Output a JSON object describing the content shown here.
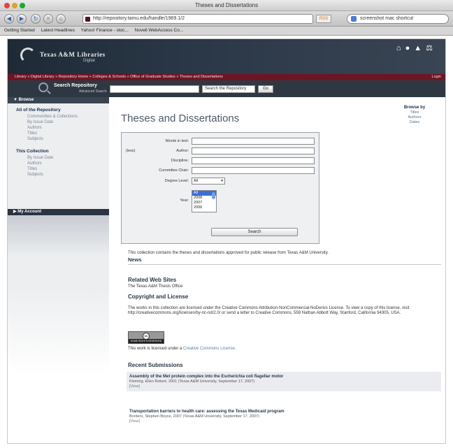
{
  "window": {
    "title": "Theses and Dissertations"
  },
  "toolbar": {
    "url": "http://repository.tamu.edu/handle/1969.1/2",
    "search_value": "screenshot mac shortcut"
  },
  "bookmarks": [
    "Getting Started",
    "Latest Headlines",
    "Yahoo! Finance - stoc...",
    "Novell WebAccess Co..."
  ],
  "header": {
    "logo_title": "Texas A&M Libraries",
    "logo_sub": "Digital"
  },
  "crumbs": {
    "path": "Library  »  Digital Library  »  Repository Home  »  Colleges & Schools  »  Office of Graduate Studies  »  Theses and Dissertations",
    "login": "Login"
  },
  "search": {
    "label": "Search Repository",
    "advanced": "Advanced Search",
    "scope": "Search the Repository",
    "go": "Go"
  },
  "sidebar": {
    "browse_head": "Browse",
    "sections": [
      {
        "title": "All of the Repository",
        "links": [
          "Communities & Collections",
          "By Issue Date",
          "Authors",
          "Titles",
          "Subjects"
        ]
      },
      {
        "title": "This Collection",
        "links": [
          "By Issue Date",
          "Authors",
          "Titles",
          "Subjects"
        ]
      }
    ],
    "account": "My Account"
  },
  "browse_by": {
    "title": "Browse by",
    "items": [
      "Titles",
      "Authors",
      "Dates"
    ]
  },
  "main": {
    "title": "Theses and Dissertations",
    "form": {
      "words": "Words in text:",
      "author_pre": "(less)",
      "author": "Author:",
      "discipline": "Discipline:",
      "committee": "Committee Chair:",
      "degree": "Degree Level:",
      "degree_value": "All",
      "year": "Year:",
      "years": [
        "All",
        "2008",
        "2007",
        "2006"
      ],
      "search_button": "Search"
    },
    "description": "This collection contains the theses and dissertations approved for public release from Texas A&M University.",
    "news": "News",
    "related_title": "Related Web Sites",
    "related_link": "The Texas A&M Thesis Office",
    "copyright_title": "Copyright and License",
    "copyright_text": "The works in this collection are licensed under the Creative Commons Attribution-NonCommercial-NoDerivs License. To view a copy of this license, visit http://creativecommons.org/licenses/by-nc-nd/2.0/ or send a letter to Creative Commons, 559 Nathan Abbott Way, Stanford, California 94305, USA.",
    "cc_badge": "SOME RIGHTS RESERVED",
    "license_pre": "This work is licensed under a ",
    "license_link": "Creative Commons License",
    "license_post": ".",
    "recent_title": "Recent Submissions",
    "submissions": [
      {
        "title": "Assembly of the Met protein complex into the Escherichia coli flagellar motor",
        "meta": "Fleming, Ellen Robert, 2001 (Texas A&M University, September 17, 2007)",
        "view": "[View]"
      },
      {
        "title": "Transportation barriers to health care: assessing the Texas Medicaid program",
        "meta": "Borders, Stephen Boyce, 2007 (Texas A&M University, September 17, 2007)",
        "view": "[View]"
      }
    ]
  }
}
